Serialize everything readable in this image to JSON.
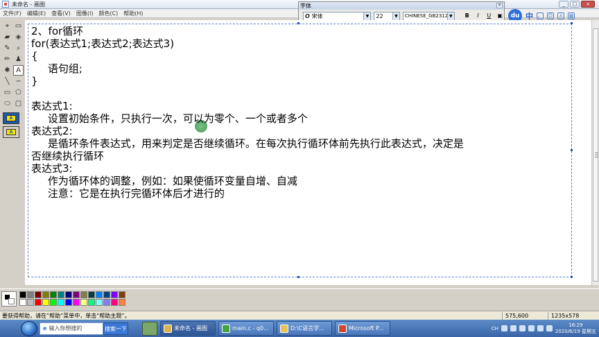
{
  "window": {
    "title": "未命名 - 画图",
    "buttons": [
      "_",
      "□",
      "×"
    ]
  },
  "menu": [
    "文件(F)",
    "编辑(E)",
    "查看(V)",
    "图像(I)",
    "颜色(C)",
    "帮助(H)"
  ],
  "tools": [
    {
      "icon": "free-select-icon",
      "glyph": "⌖"
    },
    {
      "icon": "rect-select-icon",
      "glyph": "▭"
    },
    {
      "icon": "eraser-icon",
      "glyph": "▰"
    },
    {
      "icon": "fill-icon",
      "glyph": "◈"
    },
    {
      "icon": "eyedropper-icon",
      "glyph": "✎"
    },
    {
      "icon": "magnifier-icon",
      "glyph": "⌕"
    },
    {
      "icon": "pencil-icon",
      "glyph": "✏"
    },
    {
      "icon": "brush-icon",
      "glyph": "♟"
    },
    {
      "icon": "airbrush-icon",
      "glyph": "✺"
    },
    {
      "icon": "text-icon",
      "glyph": "A"
    },
    {
      "icon": "line-icon",
      "glyph": "╲"
    },
    {
      "icon": "curve-icon",
      "glyph": "∽"
    },
    {
      "icon": "rectangle-icon",
      "glyph": "▭"
    },
    {
      "icon": "polygon-icon",
      "glyph": "⬠"
    },
    {
      "icon": "ellipse-icon",
      "glyph": "⬭"
    },
    {
      "icon": "rounded-rect-icon",
      "glyph": "▢"
    }
  ],
  "active_tool_index": 9,
  "font_toolbar": {
    "title": "字体",
    "font_name": "宋体",
    "font_size": "22",
    "charset": "CHINESE_GB2312",
    "format_buttons": [
      "B",
      "I",
      "U",
      "▣"
    ]
  },
  "ime": {
    "logo": "du",
    "mode": "中"
  },
  "canvas_lines": [
    "2、for循环",
    "for(表达式1;表达式2;表达式3)",
    "{",
    "     语句组;",
    "}",
    "",
    "表达式1:",
    "     设置初始条件，只执行一次，可以为零个、一个或者多个",
    "表达式2:",
    "     是循环条件表达式，用来判定是否继续循环。在每次执行循环体前先执行此表达式，决定是",
    "否继续执行循环",
    "表达式3:",
    "     作为循环体的调整，例如：如果使循环变量自增、自减",
    "     注意：它是在执行完循环体后才进行的"
  ],
  "palette": [
    "#000000",
    "#808080",
    "#800000",
    "#808000",
    "#008000",
    "#008080",
    "#000080",
    "#800080",
    "#808040",
    "#004040",
    "#0080ff",
    "#004080",
    "#8000ff",
    "#804000",
    "#ffffff",
    "#c0c0c0",
    "#ff0000",
    "#ffff00",
    "#00ff00",
    "#00ffff",
    "#0000ff",
    "#ff00ff",
    "#ffff80",
    "#00ff80",
    "#80ffff",
    "#8080ff",
    "#ff0080",
    "#ff8040"
  ],
  "status": {
    "help": "要获得帮助，请在“帮助”菜单中，单击“帮助主题”。",
    "cursor_pos": "575,600",
    "canvas_size": "1235x578"
  },
  "taskbar": {
    "search_placeholder": "输入你想搜的",
    "search_button": "搜索一下",
    "tasks": [
      {
        "label": "未命名 - 画图",
        "color": "#d9b34a",
        "active": true
      },
      {
        "label": "main.c - q0...",
        "color": "#41a33f",
        "active": false
      },
      {
        "label": "D:\\C语言学...",
        "color": "#e8c252",
        "active": false
      },
      {
        "label": "Microsoft P...",
        "color": "#d2472f",
        "active": false
      }
    ],
    "ime_tag": "CH",
    "time": "16:29",
    "date": "2020/6/19 星期五"
  }
}
